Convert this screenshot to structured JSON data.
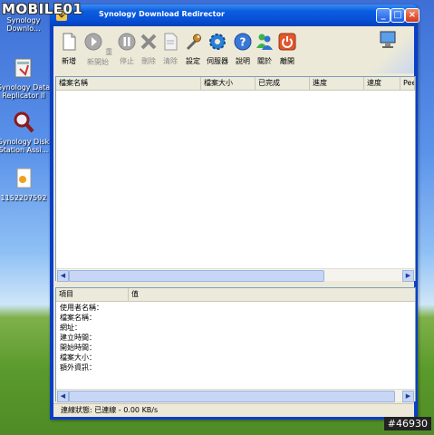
{
  "watermark": "MOBILE01",
  "image_id": "#46930",
  "desktop": {
    "icons": [
      {
        "label_1": "Synology",
        "label_2": "Downlo..."
      },
      {
        "label_1": "Synology Data",
        "label_2": "Replicator II"
      },
      {
        "label_1": "Synology Disk",
        "label_2": "Station Assi..."
      },
      {
        "label_1": "1152207592",
        "label_2": ""
      }
    ]
  },
  "window": {
    "title": "Synology Download Redirector",
    "title_buttons": {
      "minimize": "_",
      "maximize": "□",
      "close": "×"
    },
    "toolbar": [
      {
        "label": "新增",
        "icon": "new-file-icon",
        "enabled": true
      },
      {
        "label": "重新開始",
        "icon": "play-icon",
        "enabled": false
      },
      {
        "label": "停止",
        "icon": "pause-icon",
        "enabled": false
      },
      {
        "label": "刪除",
        "icon": "delete-icon",
        "enabled": false
      },
      {
        "label": "清除",
        "icon": "clear-icon",
        "enabled": false
      },
      {
        "label": "設定",
        "icon": "wrench-icon",
        "enabled": true
      },
      {
        "label": "伺服器",
        "icon": "gear-icon",
        "enabled": true
      },
      {
        "label": "說明",
        "icon": "help-icon",
        "enabled": true
      },
      {
        "label": "關於",
        "icon": "users-icon",
        "enabled": true
      },
      {
        "label": "離開",
        "icon": "power-icon",
        "enabled": true
      }
    ],
    "list_columns": [
      "檔案名稱",
      "檔案大小",
      "已完成",
      "進度",
      "速度",
      "Peer"
    ],
    "props_columns": [
      "項目",
      "值"
    ],
    "props_rows": [
      "使用者名稱：",
      "檔案名稱：",
      "網址：",
      "建立時間：",
      "開始時間：",
      "檔案大小：",
      "額外資訊："
    ],
    "status_text": "連線狀態: 已連線 - 0.00 KB/s"
  },
  "colors": {
    "titlebar": "#0650d8",
    "face": "#ece9d8",
    "accent": "#0a3fc7"
  }
}
